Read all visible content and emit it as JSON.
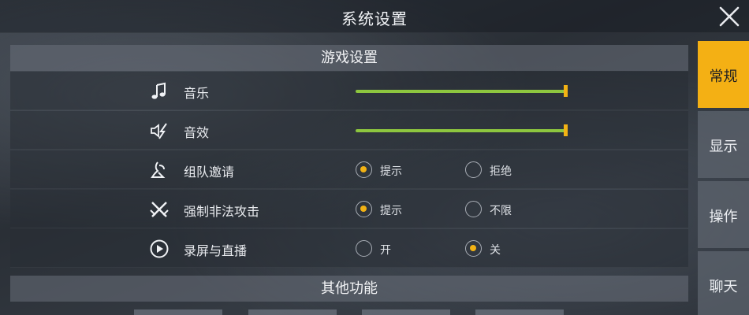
{
  "window": {
    "title": "系统设置"
  },
  "game_settings": {
    "header": "游戏设置",
    "rows": [
      {
        "label": "音乐",
        "icon": "music-note-icon",
        "type": "slider",
        "value": 1.0
      },
      {
        "label": "音效",
        "icon": "sound-effect-icon",
        "type": "slider",
        "value": 1.0
      },
      {
        "label": "组队邀请",
        "icon": "team-invite-icon",
        "type": "radio",
        "options": [
          "提示",
          "拒绝"
        ],
        "selected": "提示"
      },
      {
        "label": "强制非法攻击",
        "icon": "crossed-swords-icon",
        "type": "radio",
        "options": [
          "提示",
          "不限"
        ],
        "selected": "提示"
      },
      {
        "label": "录屏与直播",
        "icon": "play-circle-icon",
        "type": "radio",
        "options": [
          "开",
          "关"
        ],
        "selected": "关"
      }
    ]
  },
  "other_functions": {
    "header": "其他功能"
  },
  "side_tabs": [
    {
      "label": "常规",
      "active": true
    },
    {
      "label": "显示",
      "active": false
    },
    {
      "label": "操作",
      "active": false
    },
    {
      "label": "聊天",
      "active": false
    }
  ],
  "colors": {
    "accent": "#f4b014",
    "slider_fill": "#8dc63f"
  }
}
